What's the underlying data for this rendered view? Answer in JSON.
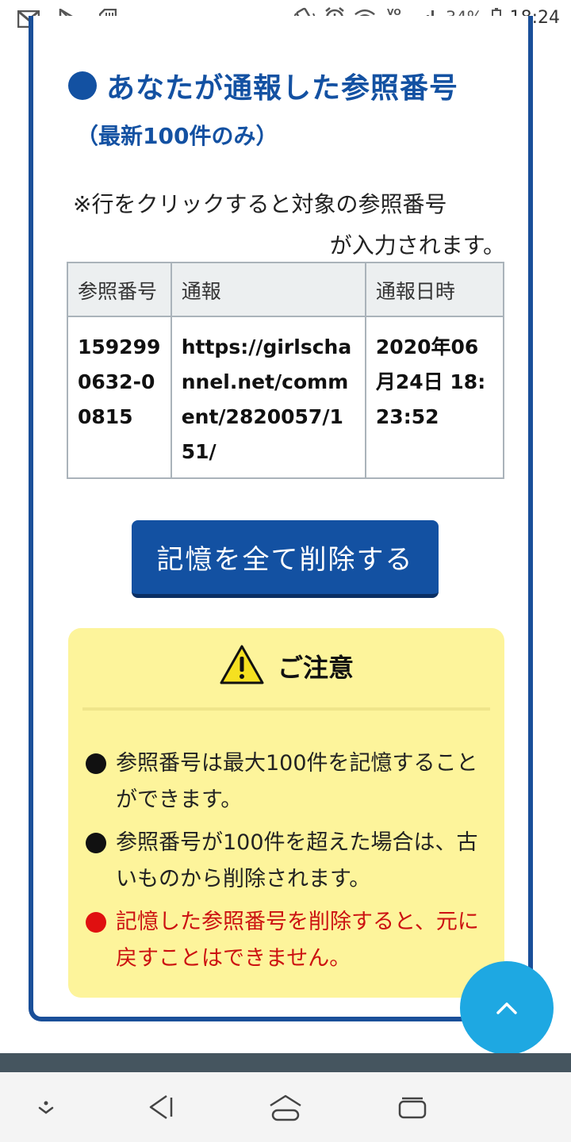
{
  "status_bar": {
    "battery": "34%",
    "time": "18:24",
    "volte": "VO LTE",
    "icons": [
      "gmail-icon",
      "play-store-icon",
      "sd-card-icon",
      "vibrate-icon",
      "alarm-icon",
      "wifi-icon",
      "volte-icon",
      "signal-icon",
      "battery-icon"
    ]
  },
  "section": {
    "title": "あなたが通報した参照番号",
    "subtitle": "（最新100件のみ）",
    "note_line1": "※行をクリックすると対象の参照番号",
    "note_line2": "が入力されます。"
  },
  "table": {
    "headers": [
      "参照番号",
      "通報",
      "通報日時"
    ],
    "rows": [
      {
        "ref": "1592990632-00815",
        "url": "https://girlschannel.net/comment/2820057/151/",
        "datetime": "2020年06月24日 18:23:52"
      }
    ]
  },
  "delete_button": {
    "label": "記憶を全て削除する"
  },
  "caution": {
    "title": "ご注意",
    "items": [
      "参照番号は最大100件を記憶することができます。",
      "参照番号が100件を超えた場合は、古いものから削除されます。",
      "記憶した参照番号を削除すると、元に戻すことはできません。"
    ]
  },
  "colors": {
    "brand_blue": "#1351a2",
    "caution_bg": "#fdf49b",
    "warning_red": "#cc1111",
    "fab": "#1ea8e2"
  }
}
